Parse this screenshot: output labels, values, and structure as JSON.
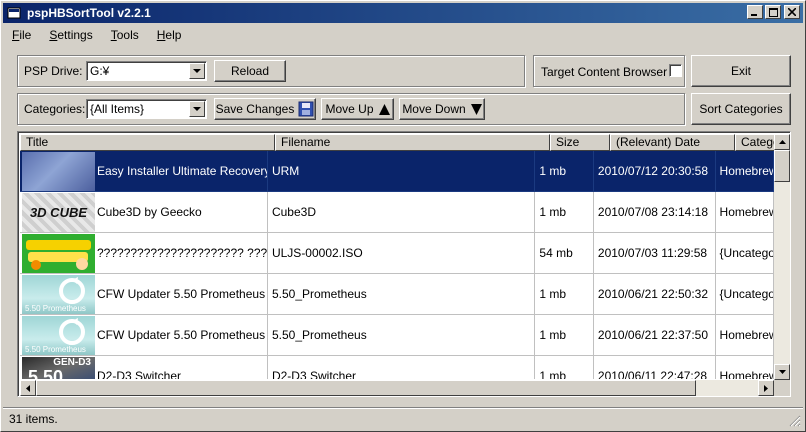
{
  "window": {
    "title": "pspHBSortTool v2.2.1",
    "controls": {
      "minimize_icon": "minimize-icon",
      "maximize_icon": "maximize-icon",
      "close_icon": "close-icon"
    }
  },
  "menu": [
    {
      "label": "File",
      "accel": "F",
      "rest": "ile"
    },
    {
      "label": "Settings",
      "accel": "S",
      "rest": "ettings"
    },
    {
      "label": "Tools",
      "accel": "T",
      "rest": "ools"
    },
    {
      "label": "Help",
      "accel": "H",
      "rest": "elp"
    }
  ],
  "toolbar": {
    "psp_drive_label": "PSP Drive:",
    "psp_drive_value": "G:¥",
    "reload_label": "Reload",
    "target_browser_label": "Target Content Browser",
    "target_browser_checked": false,
    "exit_label": "Exit",
    "categories_label": "Categories:",
    "categories_value": "{All Items}",
    "save_changes_label": "Save Changes",
    "move_up_label": "Move Up",
    "move_down_label": "Move Down",
    "sort_categories_label": "Sort Categories"
  },
  "list": {
    "columns": [
      "Title",
      "Filename",
      "Size",
      "(Relevant) Date",
      "Category"
    ],
    "rows": [
      {
        "title": "Easy Installer Ultimate Recovery...",
        "filename": "URM",
        "size": "1 mb",
        "date": "2010/07/12 20:30:58",
        "category": "Homebrew",
        "selected": true,
        "thumb": "blue"
      },
      {
        "title": "Cube3D by Geecko",
        "filename": "Cube3D",
        "size": "1 mb",
        "date": "2010/07/08 23:14:18",
        "category": "Homebrew",
        "selected": false,
        "thumb": "cube",
        "thumb_text": "3D CUBE"
      },
      {
        "title": "?????????????????????? ????????????...",
        "filename": "ULJS-00002.ISO",
        "size": "54 mb",
        "date": "2010/07/03 11:29:58",
        "category": "{Uncategorized}",
        "selected": false,
        "thumb": "game"
      },
      {
        "title": "CFW Updater 5.50 Prometheus",
        "filename": "5.50_Prometheus",
        "size": "1 mb",
        "date": "2010/06/21 22:50:32",
        "category": "{Uncategorized}",
        "selected": false,
        "thumb": "update",
        "thumb_text": "5.50 Prometheus"
      },
      {
        "title": "CFW Updater 5.50 Prometheus",
        "filename": "5.50_Prometheus",
        "size": "1 mb",
        "date": "2010/06/21 22:37:50",
        "category": "Homebrew",
        "selected": false,
        "thumb": "update",
        "thumb_text": "5.50 Prometheus"
      },
      {
        "title": "D2-D3 Switcher",
        "filename": "D2-D3 Switcher",
        "size": "1 mb",
        "date": "2010/06/11 22:47:28",
        "category": "Homebrew",
        "selected": false,
        "thumb": "gen",
        "thumb_text": "GEN-D3",
        "thumb_text2": "5.50"
      }
    ]
  },
  "status": {
    "text": "31 items."
  },
  "colors": {
    "selection": "#0a246a",
    "titlebar_start": "#0a246a",
    "titlebar_end": "#3a6ea5",
    "face": "#d4d0c8"
  }
}
